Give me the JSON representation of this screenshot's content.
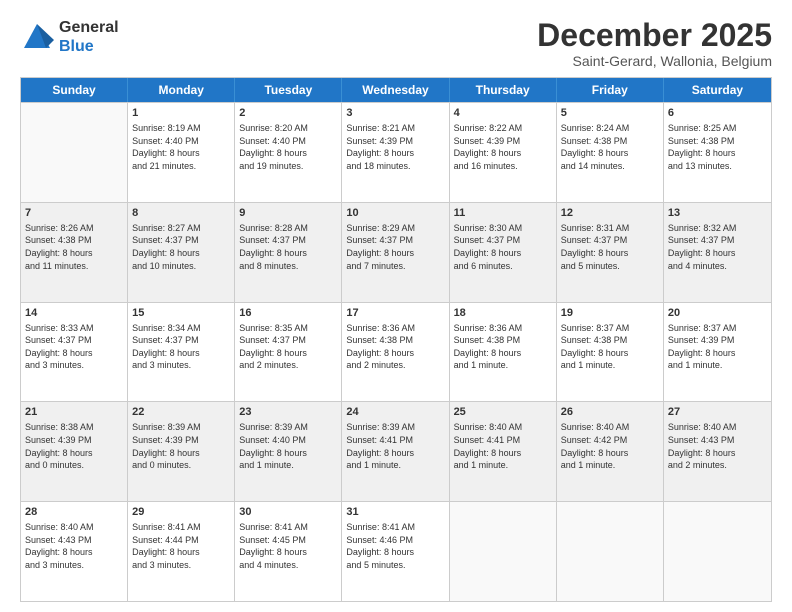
{
  "logo": {
    "general": "General",
    "blue": "Blue"
  },
  "title": "December 2025",
  "subtitle": "Saint-Gerard, Wallonia, Belgium",
  "days": [
    "Sunday",
    "Monday",
    "Tuesday",
    "Wednesday",
    "Thursday",
    "Friday",
    "Saturday"
  ],
  "rows": [
    [
      {
        "num": "",
        "lines": []
      },
      {
        "num": "1",
        "lines": [
          "Sunrise: 8:19 AM",
          "Sunset: 4:40 PM",
          "Daylight: 8 hours",
          "and 21 minutes."
        ]
      },
      {
        "num": "2",
        "lines": [
          "Sunrise: 8:20 AM",
          "Sunset: 4:40 PM",
          "Daylight: 8 hours",
          "and 19 minutes."
        ]
      },
      {
        "num": "3",
        "lines": [
          "Sunrise: 8:21 AM",
          "Sunset: 4:39 PM",
          "Daylight: 8 hours",
          "and 18 minutes."
        ]
      },
      {
        "num": "4",
        "lines": [
          "Sunrise: 8:22 AM",
          "Sunset: 4:39 PM",
          "Daylight: 8 hours",
          "and 16 minutes."
        ]
      },
      {
        "num": "5",
        "lines": [
          "Sunrise: 8:24 AM",
          "Sunset: 4:38 PM",
          "Daylight: 8 hours",
          "and 14 minutes."
        ]
      },
      {
        "num": "6",
        "lines": [
          "Sunrise: 8:25 AM",
          "Sunset: 4:38 PM",
          "Daylight: 8 hours",
          "and 13 minutes."
        ]
      }
    ],
    [
      {
        "num": "7",
        "lines": [
          "Sunrise: 8:26 AM",
          "Sunset: 4:38 PM",
          "Daylight: 8 hours",
          "and 11 minutes."
        ]
      },
      {
        "num": "8",
        "lines": [
          "Sunrise: 8:27 AM",
          "Sunset: 4:37 PM",
          "Daylight: 8 hours",
          "and 10 minutes."
        ]
      },
      {
        "num": "9",
        "lines": [
          "Sunrise: 8:28 AM",
          "Sunset: 4:37 PM",
          "Daylight: 8 hours",
          "and 8 minutes."
        ]
      },
      {
        "num": "10",
        "lines": [
          "Sunrise: 8:29 AM",
          "Sunset: 4:37 PM",
          "Daylight: 8 hours",
          "and 7 minutes."
        ]
      },
      {
        "num": "11",
        "lines": [
          "Sunrise: 8:30 AM",
          "Sunset: 4:37 PM",
          "Daylight: 8 hours",
          "and 6 minutes."
        ]
      },
      {
        "num": "12",
        "lines": [
          "Sunrise: 8:31 AM",
          "Sunset: 4:37 PM",
          "Daylight: 8 hours",
          "and 5 minutes."
        ]
      },
      {
        "num": "13",
        "lines": [
          "Sunrise: 8:32 AM",
          "Sunset: 4:37 PM",
          "Daylight: 8 hours",
          "and 4 minutes."
        ]
      }
    ],
    [
      {
        "num": "14",
        "lines": [
          "Sunrise: 8:33 AM",
          "Sunset: 4:37 PM",
          "Daylight: 8 hours",
          "and 3 minutes."
        ]
      },
      {
        "num": "15",
        "lines": [
          "Sunrise: 8:34 AM",
          "Sunset: 4:37 PM",
          "Daylight: 8 hours",
          "and 3 minutes."
        ]
      },
      {
        "num": "16",
        "lines": [
          "Sunrise: 8:35 AM",
          "Sunset: 4:37 PM",
          "Daylight: 8 hours",
          "and 2 minutes."
        ]
      },
      {
        "num": "17",
        "lines": [
          "Sunrise: 8:36 AM",
          "Sunset: 4:38 PM",
          "Daylight: 8 hours",
          "and 2 minutes."
        ]
      },
      {
        "num": "18",
        "lines": [
          "Sunrise: 8:36 AM",
          "Sunset: 4:38 PM",
          "Daylight: 8 hours",
          "and 1 minute."
        ]
      },
      {
        "num": "19",
        "lines": [
          "Sunrise: 8:37 AM",
          "Sunset: 4:38 PM",
          "Daylight: 8 hours",
          "and 1 minute."
        ]
      },
      {
        "num": "20",
        "lines": [
          "Sunrise: 8:37 AM",
          "Sunset: 4:39 PM",
          "Daylight: 8 hours",
          "and 1 minute."
        ]
      }
    ],
    [
      {
        "num": "21",
        "lines": [
          "Sunrise: 8:38 AM",
          "Sunset: 4:39 PM",
          "Daylight: 8 hours",
          "and 0 minutes."
        ]
      },
      {
        "num": "22",
        "lines": [
          "Sunrise: 8:39 AM",
          "Sunset: 4:39 PM",
          "Daylight: 8 hours",
          "and 0 minutes."
        ]
      },
      {
        "num": "23",
        "lines": [
          "Sunrise: 8:39 AM",
          "Sunset: 4:40 PM",
          "Daylight: 8 hours",
          "and 1 minute."
        ]
      },
      {
        "num": "24",
        "lines": [
          "Sunrise: 8:39 AM",
          "Sunset: 4:41 PM",
          "Daylight: 8 hours",
          "and 1 minute."
        ]
      },
      {
        "num": "25",
        "lines": [
          "Sunrise: 8:40 AM",
          "Sunset: 4:41 PM",
          "Daylight: 8 hours",
          "and 1 minute."
        ]
      },
      {
        "num": "26",
        "lines": [
          "Sunrise: 8:40 AM",
          "Sunset: 4:42 PM",
          "Daylight: 8 hours",
          "and 1 minute."
        ]
      },
      {
        "num": "27",
        "lines": [
          "Sunrise: 8:40 AM",
          "Sunset: 4:43 PM",
          "Daylight: 8 hours",
          "and 2 minutes."
        ]
      }
    ],
    [
      {
        "num": "28",
        "lines": [
          "Sunrise: 8:40 AM",
          "Sunset: 4:43 PM",
          "Daylight: 8 hours",
          "and 3 minutes."
        ]
      },
      {
        "num": "29",
        "lines": [
          "Sunrise: 8:41 AM",
          "Sunset: 4:44 PM",
          "Daylight: 8 hours",
          "and 3 minutes."
        ]
      },
      {
        "num": "30",
        "lines": [
          "Sunrise: 8:41 AM",
          "Sunset: 4:45 PM",
          "Daylight: 8 hours",
          "and 4 minutes."
        ]
      },
      {
        "num": "31",
        "lines": [
          "Sunrise: 8:41 AM",
          "Sunset: 4:46 PM",
          "Daylight: 8 hours",
          "and 5 minutes."
        ]
      },
      {
        "num": "",
        "lines": []
      },
      {
        "num": "",
        "lines": []
      },
      {
        "num": "",
        "lines": []
      }
    ]
  ]
}
